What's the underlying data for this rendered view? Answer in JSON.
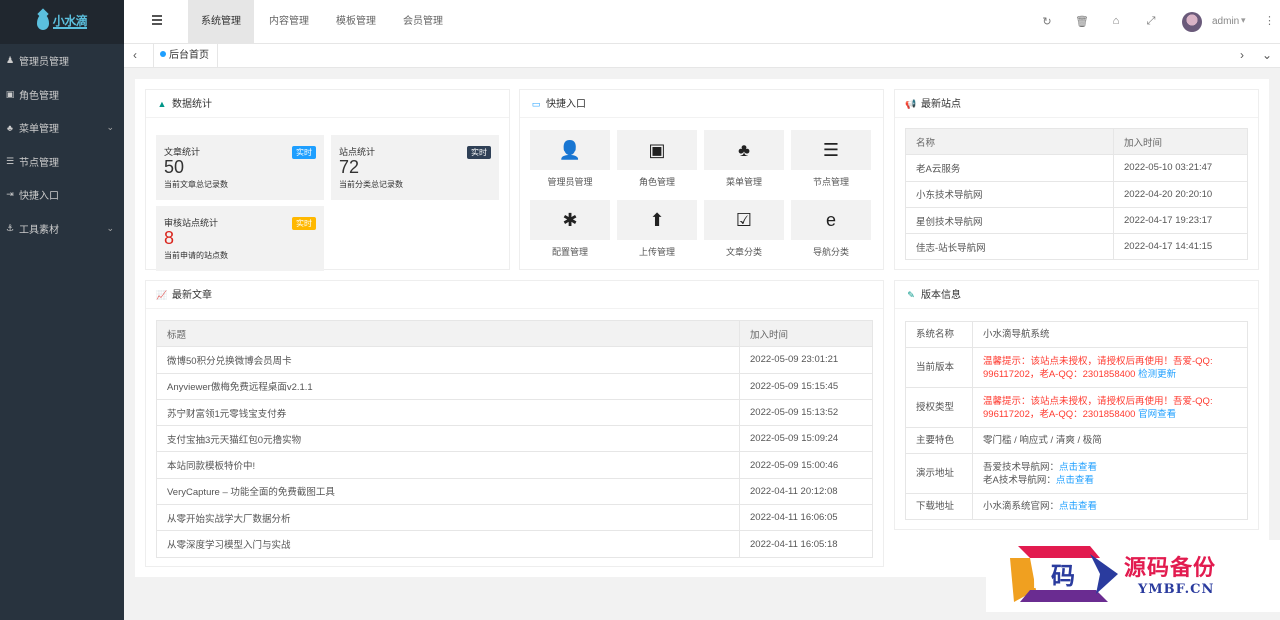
{
  "logo": {
    "text": "小水滴"
  },
  "sidebar": {
    "items": [
      {
        "label": "管理员管理",
        "icon": "user-icon",
        "glyph": "♟",
        "has_children": false
      },
      {
        "label": "角色管理",
        "icon": "id-card-icon",
        "glyph": "▣",
        "has_children": false
      },
      {
        "label": "菜单管理",
        "icon": "tree-icon",
        "glyph": "♣",
        "has_children": true
      },
      {
        "label": "节点管理",
        "icon": "list-icon",
        "glyph": "☰",
        "has_children": false
      },
      {
        "label": "快捷入口",
        "icon": "bolt-icon",
        "glyph": "⇥",
        "has_children": false
      },
      {
        "label": "工具素材",
        "icon": "anchor-icon",
        "glyph": "⚓",
        "has_children": true
      }
    ]
  },
  "header": {
    "tabs": [
      {
        "label": "系统管理",
        "active": true
      },
      {
        "label": "内容管理",
        "active": false
      },
      {
        "label": "模板管理",
        "active": false
      },
      {
        "label": "会员管理",
        "active": false
      }
    ],
    "user_name": "admin"
  },
  "breadcrumb": {
    "current_tab": "后台首页"
  },
  "stats_card": {
    "title": "数据统计",
    "items": [
      {
        "title": "文章统计",
        "badge": "实时",
        "badge_color": "#1e9fff",
        "value": "50",
        "value_color": "#333333",
        "desc": "当前文章总记录数"
      },
      {
        "title": "站点统计",
        "badge": "实时",
        "badge_color": "#2f4056",
        "value": "72",
        "value_color": "#333333",
        "desc": "当前分类总记录数"
      },
      {
        "title": "审核站点统计",
        "badge": "实时",
        "badge_color": "#ffb800",
        "value": "8",
        "value_color": "#d9251d",
        "desc": "当前申请的站点数"
      }
    ]
  },
  "quick_card": {
    "title": "快捷入口",
    "items": [
      {
        "label": "管理员管理",
        "icon": "user-icon",
        "glyph": "👤"
      },
      {
        "label": "角色管理",
        "icon": "id-badge-icon",
        "glyph": "▣"
      },
      {
        "label": "菜单管理",
        "icon": "tree-icon",
        "glyph": "♣"
      },
      {
        "label": "节点管理",
        "icon": "list-icon",
        "glyph": "☰"
      },
      {
        "label": "配置管理",
        "icon": "asterisk-icon",
        "glyph": "✱"
      },
      {
        "label": "上传管理",
        "icon": "arrow-up-icon",
        "glyph": "⬆"
      },
      {
        "label": "文章分类",
        "icon": "calendar-check-icon",
        "glyph": "☑"
      },
      {
        "label": "导航分类",
        "icon": "edge-browser-icon",
        "glyph": "e"
      }
    ]
  },
  "sites_card": {
    "title": "最新站点",
    "columns": [
      "名称",
      "加入时间"
    ],
    "rows": [
      [
        "老A云服务",
        "2022-05-10 03:21:47"
      ],
      [
        "小东技术导航网",
        "2022-04-20 20:20:10"
      ],
      [
        "星创技术导航网",
        "2022-04-17 19:23:17"
      ],
      [
        "佳志-站长导航网",
        "2022-04-17 14:41:15"
      ]
    ]
  },
  "articles_card": {
    "title": "最新文章",
    "columns": [
      "标题",
      "加入时间"
    ],
    "rows": [
      [
        "微博50积分兑换微博会员周卡",
        "2022-05-09 23:01:21"
      ],
      [
        "Anyviewer傲梅免费远程桌面v2.1.1",
        "2022-05-09 15:15:45"
      ],
      [
        "苏宁财富领1元零钱宝支付券",
        "2022-05-09 15:13:52"
      ],
      [
        "支付宝抽3元天猫红包0元撸实物",
        "2022-05-09 15:09:24"
      ],
      [
        "本站同款模板特价中!",
        "2022-05-09 15:00:46"
      ],
      [
        "VeryCapture – 功能全面的免费截图工具",
        "2022-04-11 20:12:08"
      ],
      [
        "从零开始实战学大厂数据分析",
        "2022-04-11 16:06:05"
      ],
      [
        "从零深度学习模型入门与实战",
        "2022-04-11 16:05:18"
      ]
    ]
  },
  "version_card": {
    "title": "版本信息",
    "system_name_label": "系统名称",
    "system_name": "小水滴导航系统",
    "current_version_label": "当前版本",
    "current_version_warning": "温馨提示：该站点未授权，请授权后再使用！吾爱-QQ: 996117202，老A-QQ：2301858400",
    "current_version_link": "检测更新",
    "license_label": "授权类型",
    "license_warning": "温馨提示：该站点未授权，请授权后再使用！吾爱-QQ: 996117202，老A-QQ：2301858400",
    "license_link": "官网查看",
    "features_label": "主要特色",
    "features": "零门槛 / 响应式 / 清爽 / 极简",
    "demo_label": "演示地址",
    "demo_line1_prefix": "吾爱技术导航网：",
    "demo_line1_link": "点击查看",
    "demo_line2_prefix": "老A技术导航网：",
    "demo_line2_link": "点击查看",
    "download_label": "下载地址",
    "download_prefix": "小水滴系统官网：",
    "download_link": "点击查看"
  },
  "watermark": {
    "char": "码",
    "text1": "源码备份",
    "text2": "YMBF.CN"
  }
}
